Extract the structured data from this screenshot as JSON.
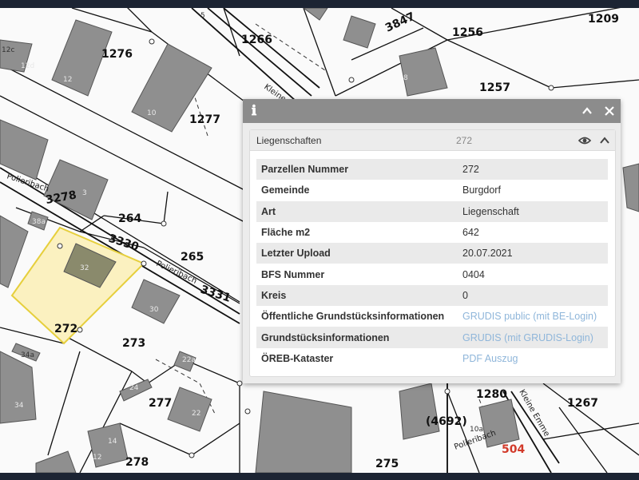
{
  "map": {
    "parcel_numbers": [
      "1276",
      "1266",
      "1256",
      "1209",
      "1257",
      "1277",
      "264",
      "265",
      "272",
      "273",
      "277",
      "278",
      "275",
      "1280",
      "1267",
      "(4692)"
    ],
    "street_numbers": [
      "3278",
      "3330",
      "3331",
      "3847"
    ],
    "street_names": [
      "Polieribach",
      "Polieribach",
      "Polieribach",
      "Kleine Emme",
      "Kleine"
    ],
    "house_numbers": [
      "12c",
      "12d",
      "12",
      "10",
      "3",
      "38a",
      "32",
      "30",
      "34a",
      "34",
      "22a",
      "22",
      "24",
      "14",
      "12",
      "8",
      "10a",
      "5"
    ],
    "highlight_number": "504",
    "highlight_color": "#d23a2a",
    "selection_fill": "#fbf1c0",
    "selection_stroke": "#e6cf3c"
  },
  "popup": {
    "info_icon": "ℹ",
    "collapse_icon": "⌃",
    "close_icon": "✕",
    "section_title": "Liegenschaften",
    "section_count": "272",
    "rows": [
      {
        "key": "Parzellen Nummer",
        "value": "272"
      },
      {
        "key": "Gemeinde",
        "value": "Burgdorf"
      },
      {
        "key": "Art",
        "value": "Liegenschaft"
      },
      {
        "key": "Fläche m2",
        "value": "642"
      },
      {
        "key": "Letzter Upload",
        "value": "20.07.2021"
      },
      {
        "key": "BFS Nummer",
        "value": "0404"
      },
      {
        "key": "Kreis",
        "value": "0"
      },
      {
        "key": "Öffentliche Grundstücksinformationen",
        "value": "GRUDIS public (mit BE-Login)",
        "link": true
      },
      {
        "key": "Grundstücksinformationen",
        "value": "GRUDIS (mit GRUDIS-Login)",
        "link": true
      },
      {
        "key": "ÖREB-Kataster",
        "value": "PDF Auszug",
        "link": true
      }
    ],
    "link_color": "#8fb6da"
  }
}
